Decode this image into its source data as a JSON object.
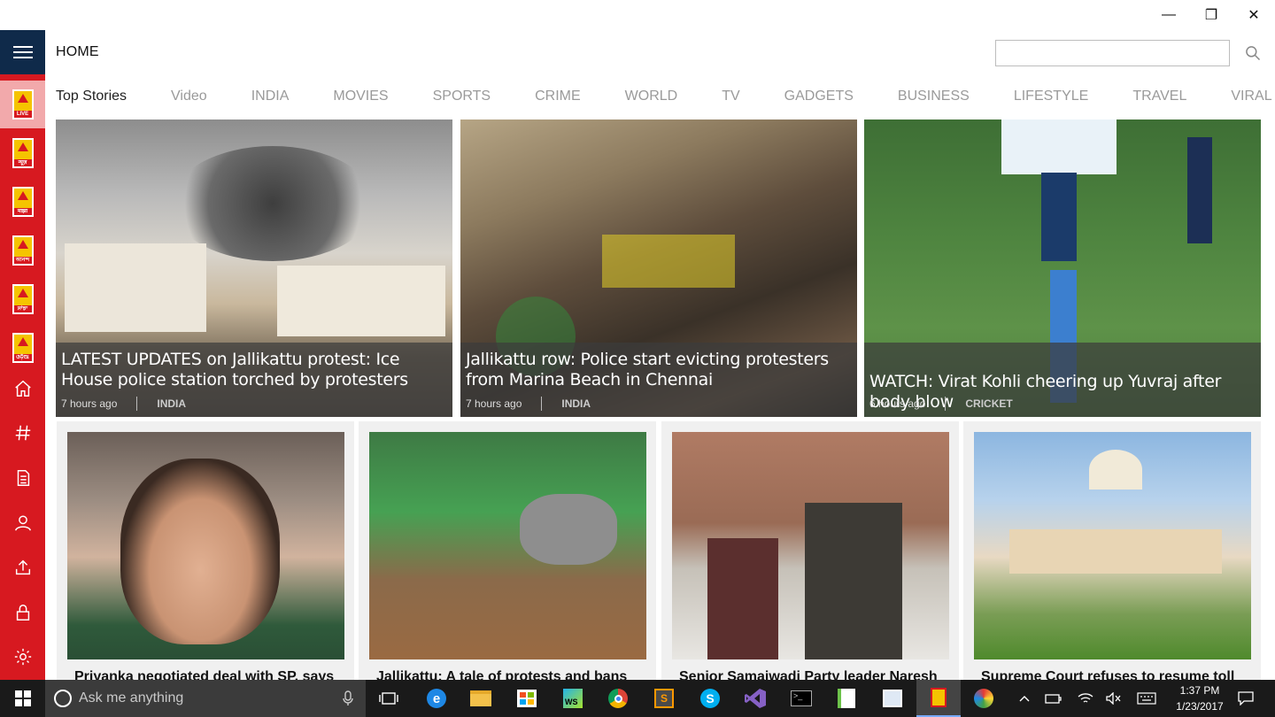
{
  "window": {
    "controls": {
      "minimize": "—",
      "maximize": "❐",
      "close": "✕"
    }
  },
  "header": {
    "title": "HOME",
    "search_placeholder": ""
  },
  "sidebar": {
    "logos": [
      "LIVE",
      "न्यूज़",
      "माझा",
      "আনন্দ",
      "ਸਾਂਝਾ",
      "ଓଡ଼ିଆ"
    ],
    "icons": [
      "home-icon",
      "hashtag-icon",
      "document-icon",
      "user-icon",
      "share-icon",
      "lock-icon",
      "settings-icon"
    ]
  },
  "tabs": [
    "Top Stories",
    "Video",
    "INDIA",
    "MOVIES",
    "SPORTS",
    "CRIME",
    "WORLD",
    "TV",
    "GADGETS",
    "BUSINESS",
    "LIFESTYLE",
    "TRAVEL",
    "VIRAL SACH"
  ],
  "top_stories": [
    {
      "title": "LATEST UPDATES on Jallikattu protest: Ice House police station torched by protesters",
      "time": "7 hours ago",
      "category": "INDIA"
    },
    {
      "title": "Jallikattu row: Police start evicting protesters from Marina Beach in Chennai",
      "time": "7 hours ago",
      "category": "INDIA"
    },
    {
      "title": "WATCH: Virat Kohli cheering up Yuvraj after body blow",
      "time": "6 hours ago",
      "category": "CRICKET"
    }
  ],
  "more_stories": [
    {
      "headline": "Priyanka negotiated deal with SP, says"
    },
    {
      "headline": "Jallikattu: A tale of protests and bans"
    },
    {
      "headline": "Senior Samajwadi Party leader Naresh"
    },
    {
      "headline": "Supreme Court refuses to resume toll"
    }
  ],
  "taskbar": {
    "search_placeholder": "Ask me anything",
    "time": "1:37 PM",
    "date": "1/23/2017"
  }
}
